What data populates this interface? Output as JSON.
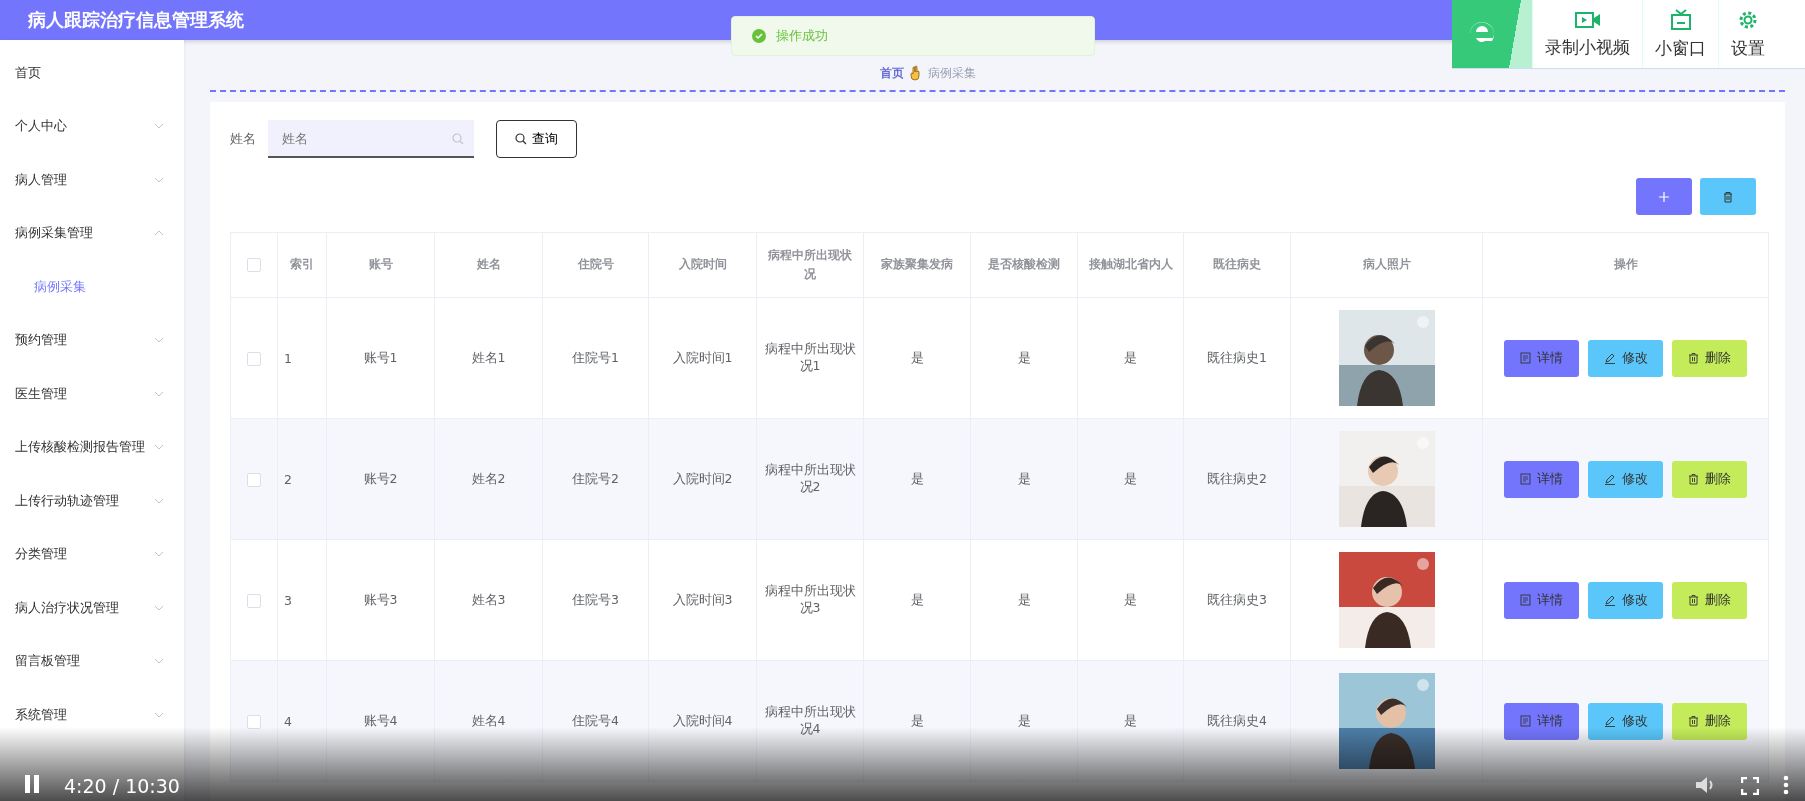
{
  "header": {
    "title": "病人跟踪治疗信息管理系统"
  },
  "sidebar": {
    "items": [
      {
        "label": "首页"
      },
      {
        "label": "个人中心",
        "expanded": false
      },
      {
        "label": "病人管理",
        "expanded": false
      },
      {
        "label": "病例采集管理",
        "expanded": true,
        "children": [
          {
            "label": "病例采集",
            "selected": true
          }
        ]
      },
      {
        "label": "预约管理",
        "expanded": false
      },
      {
        "label": "医生管理",
        "expanded": false
      },
      {
        "label": "上传核酸检测报告管理",
        "expanded": false
      },
      {
        "label": "上传行动轨迹管理",
        "expanded": false
      },
      {
        "label": "分类管理",
        "expanded": false
      },
      {
        "label": "病人治疗状况管理",
        "expanded": false
      },
      {
        "label": "留言板管理",
        "expanded": false
      },
      {
        "label": "系统管理",
        "expanded": false
      }
    ]
  },
  "breadcrumb": [
    "首页",
    "病例采集"
  ],
  "toast": {
    "message": "操作成功"
  },
  "plugin_toolbar": {
    "buttons": [
      "录制小视频",
      "小窗口",
      "设置"
    ]
  },
  "search": {
    "label": "姓名",
    "placeholder": "姓名",
    "button": "查询"
  },
  "table": {
    "all_selected": false,
    "columns": [
      "索引",
      "账号",
      "姓名",
      "住院号",
      "入院时间",
      "病程中所出现状况",
      "家族聚集发病",
      "是否核酸检测",
      "接触湖北省内人",
      "既往病史",
      "病人照片",
      "操作"
    ],
    "rows": [
      {
        "selected": false,
        "cells": [
          "1",
          "账号1",
          "姓名1",
          "住院号1",
          "入院时间1",
          "病程中所出现状况1",
          "是",
          "是",
          "是",
          "既往病史1"
        ],
        "photo": {
          "kind": "picture"
        },
        "actions": [
          "详情",
          "修改",
          "删除"
        ]
      },
      {
        "selected": false,
        "cells": [
          "2",
          "账号2",
          "姓名2",
          "住院号2",
          "入院时间2",
          "病程中所出现状况2",
          "是",
          "是",
          "是",
          "既往病史2"
        ],
        "photo": {
          "kind": "picture"
        },
        "actions": [
          "详情",
          "修改",
          "删除"
        ]
      },
      {
        "selected": false,
        "cells": [
          "3",
          "账号3",
          "姓名3",
          "住院号3",
          "入院时间3",
          "病程中所出现状况3",
          "是",
          "是",
          "是",
          "既往病史3"
        ],
        "photo": {
          "kind": "picture"
        },
        "actions": [
          "详情",
          "修改",
          "删除"
        ]
      },
      {
        "selected": false,
        "cells": [
          "4",
          "账号4",
          "姓名4",
          "住院号4",
          "入院时间4",
          "病程中所出现状况4",
          "是",
          "是",
          "是",
          "既往病史4"
        ],
        "photo": {
          "kind": "picture"
        },
        "actions": [
          "详情",
          "修改",
          "删除"
        ]
      }
    ]
  },
  "player": {
    "playing": true,
    "time": "4:20 / 10:30"
  }
}
